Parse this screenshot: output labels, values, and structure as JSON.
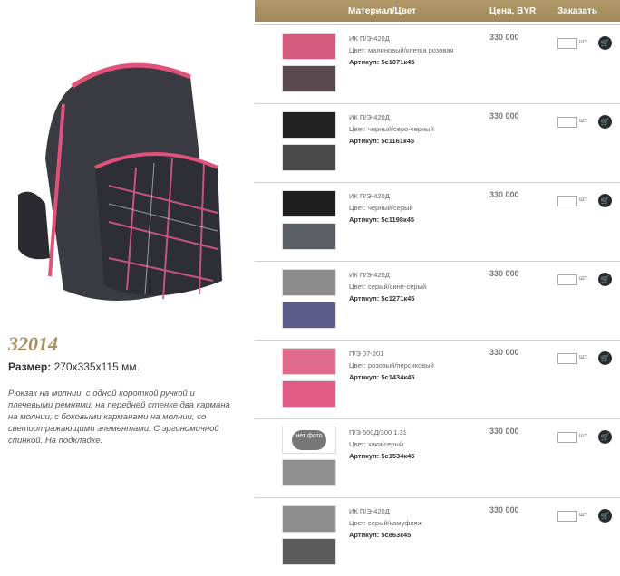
{
  "product": {
    "sku": "32014",
    "size_label": "Размер:",
    "size_value": "270x335x115 мм.",
    "description": "Рюкзак на молнии, с одной короткой ручкой и плечевыми ремнями, на передней стенке два кармана на молнии, с боковыми карманами на молнии, со светоотражающими элементами. С эргономичной спинкой. На подкладке."
  },
  "table": {
    "headers": {
      "material": "Материал/Цвет",
      "price": "Цена, BYR",
      "order": "Заказать"
    },
    "unit_label": "шт.",
    "rows": [
      {
        "material": "ИК П/Э-420Д",
        "color": "Цвет: малиновый/клетка розовая",
        "article": "Артикул: 5с1071к45",
        "price": "330 000",
        "swatch_top": "#d45b7d",
        "swatch_bottom": "#5a4a50",
        "no_photo": false
      },
      {
        "material": "ИК П/Э-420Д",
        "color": "Цвет: черный/серо-черный",
        "article": "Артикул: 5с1161к45",
        "price": "330 000",
        "swatch_top": "#222222",
        "swatch_bottom": "#4a4a4a",
        "no_photo": false
      },
      {
        "material": "ИК П/Э-420Д",
        "color": "Цвет: черный/серый",
        "article": "Артикул: 5с1198к45",
        "price": "330 000",
        "swatch_top": "#1e1e1e",
        "swatch_bottom": "#5a5f66",
        "no_photo": false
      },
      {
        "material": "ИК П/Э-420Д",
        "color": "Цвет: серый/сине-серый",
        "article": "Артикул: 5с1271к45",
        "price": "330 000",
        "swatch_top": "#8c8c8c",
        "swatch_bottom": "#5c5c8a",
        "no_photo": false
      },
      {
        "material": "П/Э 07-201",
        "color": "Цвет: розовый/персиковый",
        "article": "Артикул: 5с1434к45",
        "price": "330 000",
        "swatch_top": "#df6a8b",
        "swatch_bottom": "#e05a85",
        "no_photo": false
      },
      {
        "material": "П/Э 600Д/300 1.31",
        "color": "Цвет: хаки/серый",
        "article": "Артикул: 5с1534к45",
        "price": "330 000",
        "swatch_top": "#ffffff",
        "swatch_bottom": "#8f8f8f",
        "no_photo": true,
        "no_photo_label": "нет фото"
      },
      {
        "material": "ИК П/Э-420Д",
        "color": "Цвет: серый/камуфляж",
        "article": "Артикул: 5с863к45",
        "price": "330 000",
        "swatch_top": "#8e8e8e",
        "swatch_bottom": "#5a5a5a",
        "no_photo": false
      }
    ]
  }
}
